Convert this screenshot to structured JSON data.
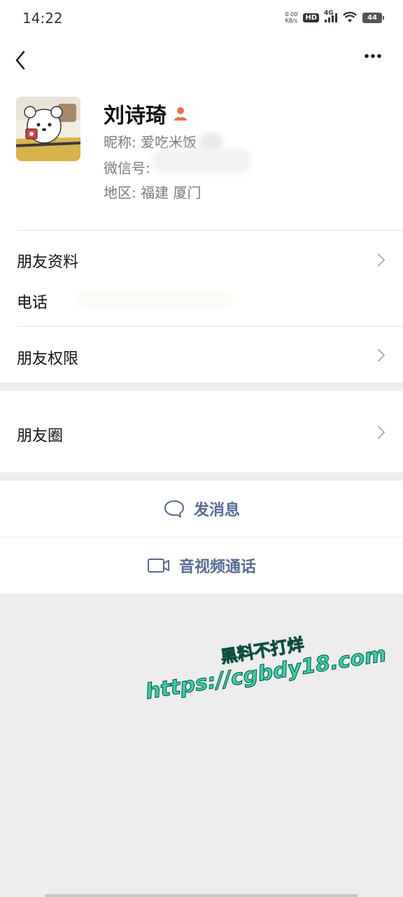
{
  "status_bar": {
    "time": "14:22",
    "net_speed_value": "0.00",
    "net_speed_unit": "KB/s",
    "hd": "HD",
    "network": "4G",
    "battery": "44"
  },
  "profile": {
    "name": "刘诗琦",
    "nickname": "昵称: 爱吃米饭",
    "wechat_id": "微信号:",
    "region": "地区: 福建  厦门"
  },
  "rows": {
    "friend_info": "朋友资料",
    "phone": "电话",
    "permissions": "朋友权限",
    "moments": "朋友圈"
  },
  "actions": {
    "message": "发消息",
    "call": "音视频通话"
  },
  "watermark": {
    "line1": "黑料不打烊",
    "line2": "https://cgbdy18.com"
  },
  "colors": {
    "link_blue": "#576b95",
    "background": "#ededed",
    "watermark_green": "#33d3a8"
  },
  "icons": [
    "back-arrow-icon",
    "more-dots-icon",
    "person-badge-icon",
    "chevron-right-icon",
    "chat-bubble-icon",
    "video-camera-icon"
  ]
}
